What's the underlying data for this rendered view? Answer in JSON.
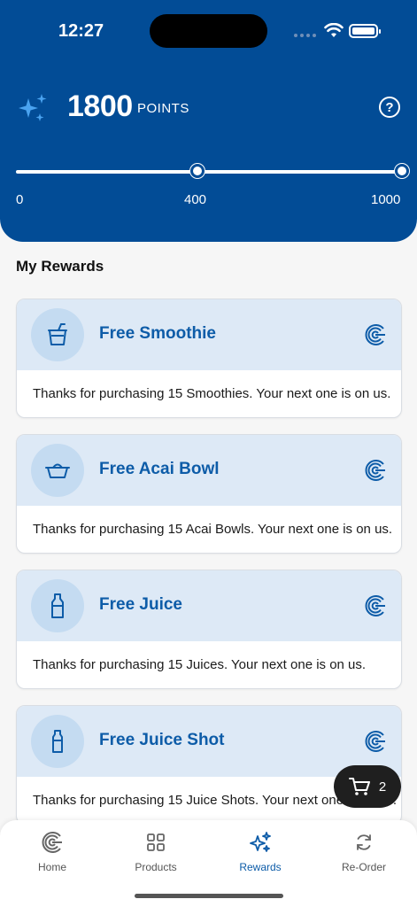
{
  "status_bar": {
    "time": "12:27"
  },
  "points": {
    "value": "1800",
    "label": "POINTS",
    "help_symbol": "?"
  },
  "progress": {
    "ticks": [
      "0",
      "400",
      "1000"
    ],
    "fill_fraction": 1.0
  },
  "section_title": "My Rewards",
  "rewards": [
    {
      "title": "Free Smoothie",
      "description": "Thanks for purchasing 15 Smoothies. Your next one is on us.",
      "icon": "cup-icon"
    },
    {
      "title": "Free Acai Bowl",
      "description": "Thanks for purchasing 15 Acai Bowls. Your next one is on us.",
      "icon": "bowl-icon"
    },
    {
      "title": "Free Juice",
      "description": "Thanks for purchasing 15 Juices. Your next one is on us.",
      "icon": "bottle-icon"
    },
    {
      "title": "Free Juice Shot",
      "description": "Thanks for purchasing 15 Juice Shots. Your next one is on us.",
      "icon": "shot-icon"
    }
  ],
  "cart": {
    "count": "2"
  },
  "nav": {
    "home": "Home",
    "products": "Products",
    "rewards": "Rewards",
    "reorder": "Re-Order"
  },
  "colors": {
    "primary": "#024c96",
    "accent": "#0d5ca8",
    "card_header": "#dde9f6"
  }
}
